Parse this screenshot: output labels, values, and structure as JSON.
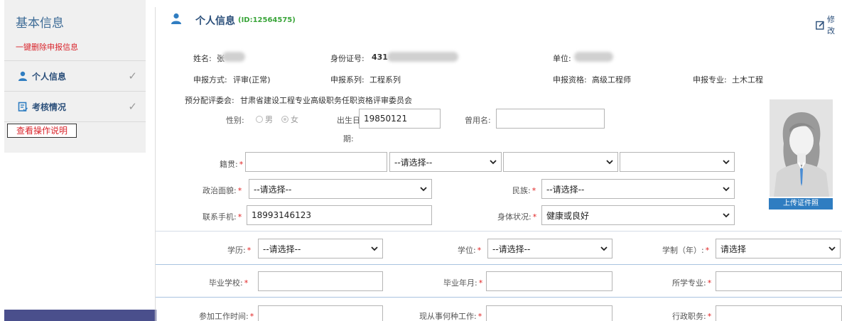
{
  "sidebar": {
    "title": "基本信息",
    "delete_link": "一键删除申报信息",
    "items": [
      {
        "label": "个人信息"
      },
      {
        "label": "考核情况"
      }
    ],
    "help_button": "查看操作说明"
  },
  "header": {
    "title": "个人信息",
    "id_text": "(ID:12564575)",
    "edit_label": "修改"
  },
  "info": {
    "name_label": "姓名:",
    "name_value": "张",
    "idcard_label": "身份证号:",
    "idcard_value": "431",
    "unit_label": "单位:",
    "method_label": "申报方式:",
    "method_value": "评审(正常)",
    "series_label": "申报系列:",
    "series_value": "工程系列",
    "qual_label": "申报资格:",
    "qual_value": "高级工程师",
    "major_label": "申报专业:",
    "major_value": "土木工程",
    "committee_label": "预分配评委会:",
    "committee_value": "甘肃省建设工程专业高级职务任职资格评审委员会"
  },
  "form": {
    "gender_label": "性别:",
    "gender_options": [
      "男",
      "女"
    ],
    "birth_label_1": "出生日",
    "birth_label_2": "期:",
    "birth_value": "19850121",
    "former_name_label": "曾用名:",
    "native_label": "籍贯:",
    "native_select_placeholder": "--请选择--",
    "political_label": "政治面貌:",
    "political_value": "--请选择--",
    "ethnic_label": "民族:",
    "ethnic_value": "--请选择--",
    "phone_label": "联系手机:",
    "phone_value": "18993146123",
    "health_label": "身体状况:",
    "health_value": "健康或良好",
    "education_label": "学历:",
    "education_value": "--请选择--",
    "degree_label": "学位:",
    "degree_value": "--请选择--",
    "schooling_label": "学制（年）:",
    "schooling_value": "请选择",
    "school_label": "毕业学校:",
    "grad_date_label": "毕业年月:",
    "study_major_label": "所学专业:",
    "work_start_label": "参加工作时间:",
    "current_job_label": "现从事何种工作:",
    "admin_post_label": "行政职务:",
    "required_mark": "*"
  },
  "photo": {
    "upload_label": "上传证件照"
  }
}
